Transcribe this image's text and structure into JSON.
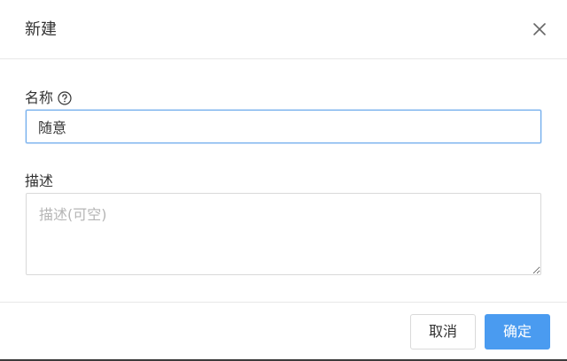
{
  "dialog": {
    "title": "新建",
    "close_icon": "close-icon"
  },
  "form": {
    "name_label": "名称",
    "name_help_icon": "question-circle-icon",
    "name_value": "随意",
    "description_label": "描述",
    "description_placeholder": "描述(可空)",
    "description_value": ""
  },
  "footer": {
    "cancel_label": "取消",
    "confirm_label": "确定"
  },
  "colors": {
    "primary": "#4a9bf0",
    "input_focus_border": "#6aa9ec",
    "border": "#d9d9d9",
    "divider": "#e8e8e8"
  }
}
